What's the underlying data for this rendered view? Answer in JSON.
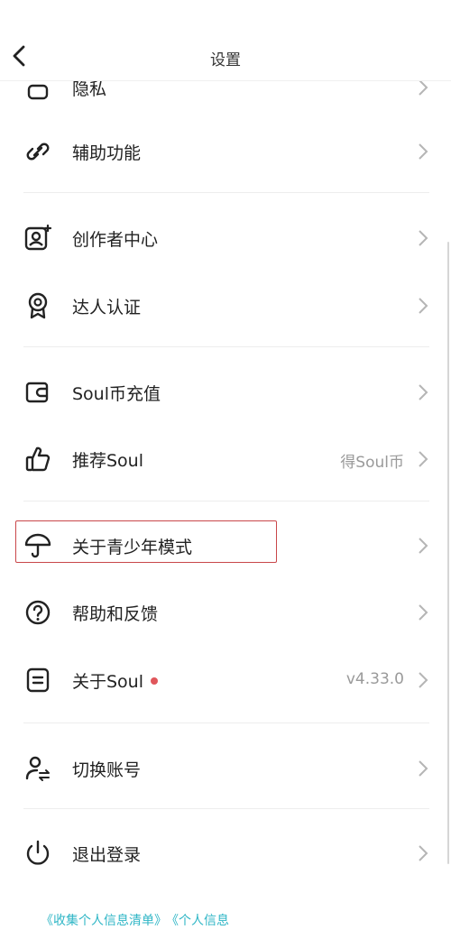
{
  "header": {
    "title": "设置",
    "back_icon": "chevron-left-icon"
  },
  "settings": {
    "privacy": {
      "label": "隐私",
      "icon": "lock-icon"
    },
    "accessibility": {
      "label": "辅助功能",
      "icon": "link-icon"
    },
    "creator_center": {
      "label": "创作者中心",
      "icon": "creator-icon"
    },
    "expert_verify": {
      "label": "达人认证",
      "icon": "badge-icon"
    },
    "recharge": {
      "label": "Soul币充值",
      "icon": "wallet-icon"
    },
    "recommend": {
      "label": "推荐Soul",
      "value": "得Soul币",
      "icon": "thumbs-up-icon"
    },
    "youth_mode": {
      "label": "关于青少年模式",
      "icon": "umbrella-icon"
    },
    "help": {
      "label": "帮助和反馈",
      "icon": "help-circle-icon"
    },
    "about": {
      "label": "关于Soul",
      "value": "v4.33.0",
      "icon": "document-icon",
      "has_badge": true
    },
    "switch_account": {
      "label": "切换账号",
      "icon": "switch-user-icon"
    },
    "logout": {
      "label": "退出登录",
      "icon": "power-icon"
    }
  },
  "footer": {
    "link1": "《收集个人信息清单》",
    "link2": "《个人信息"
  },
  "colors": {
    "accent_link": "#2fb6c6",
    "badge": "#e0565b",
    "highlight_box": "#c9474a"
  }
}
